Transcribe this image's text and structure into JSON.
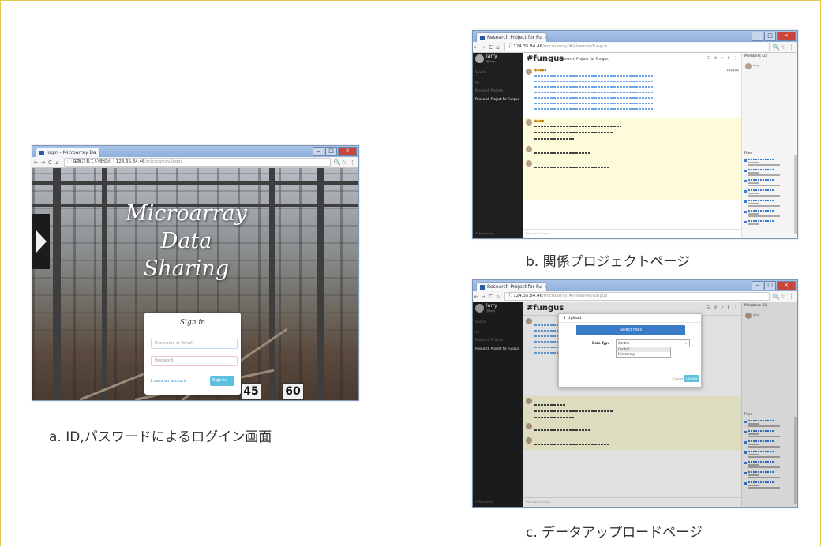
{
  "captions": {
    "a": "a.  ID,パスワードによるログイン画面",
    "b": "b.  関係プロジェクトページ",
    "c": "c.  データアップロードページ"
  },
  "login": {
    "tab_title": "login - Microarray Da",
    "url_warning": "保護されていません",
    "url_host": "124.35.84.46",
    "url_path": "/microarray/login",
    "brand_lines": [
      "Microarray",
      "Data",
      "Sharing"
    ],
    "heading": "Sign in",
    "username_placeholder": "Username or Email",
    "password_placeholder": "Password",
    "forgot": "I need an account",
    "signin_button": "Sign in",
    "signs": [
      "45",
      "60"
    ]
  },
  "project": {
    "tab_title": "Research Project for Fu",
    "url_host": "124.35.84.46",
    "url_path": "/microarray/#/channel/fungus",
    "user_name": "larry",
    "user_sub": "@larry",
    "sidebar_items": [
      "Search",
      "All",
      "Research Projects",
      "Research Project for Fungus"
    ],
    "sidebar_footer": "© Microarray",
    "channel": "#fungus",
    "project_title": "Research Project for Fungus",
    "members_title": "Members (2)",
    "member_name": "larry",
    "files_title": "Files",
    "input_placeholder": "Message #fungus"
  },
  "upload": {
    "tab_title": "Research Project for Fu",
    "url_host": "124.35.84.46",
    "url_path": "/microarray/#/channel/fungus",
    "dialog_title": "Upload",
    "select_files": "Select Files",
    "data_type_label": "Data Type",
    "data_type_value": "Control",
    "data_type_options": [
      "Control",
      "Microarray"
    ],
    "cancel": "Cancel",
    "upload_button": "Upload"
  }
}
